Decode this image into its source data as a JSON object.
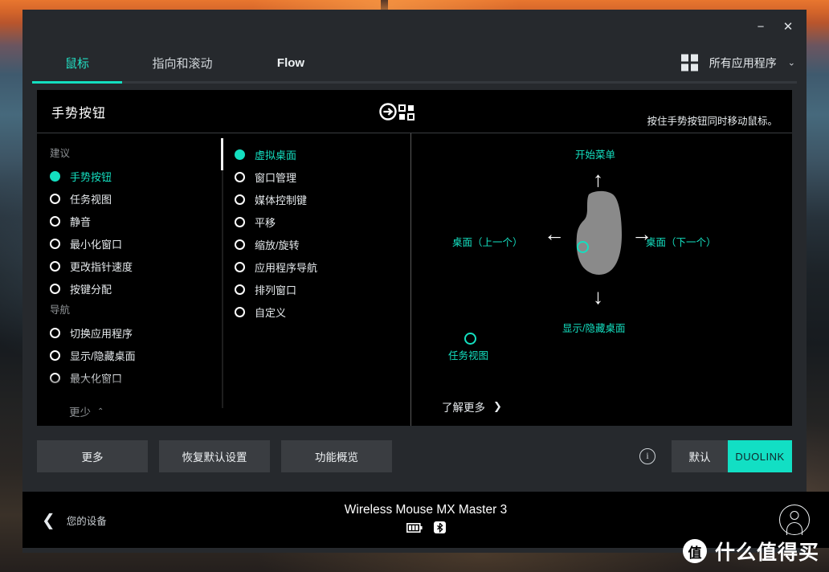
{
  "window": {
    "minimize_label": "−",
    "close_label": "✕"
  },
  "tabs": [
    {
      "label": "鼠标",
      "active": true
    },
    {
      "label": "指向和滚动",
      "active": false
    },
    {
      "label": "Flow",
      "active": false
    }
  ],
  "topbar": {
    "grid_icon": "grid-icon",
    "all_apps_label": "所有应用程序",
    "chevron": "⌄"
  },
  "card": {
    "title": "手势按钮",
    "head_icon": "gesture-button-icon",
    "hint": "按住手势按钮同时移动鼠标。"
  },
  "left_column": {
    "groups": [
      {
        "header": "建议",
        "items": [
          {
            "label": "手势按钮",
            "selected": true
          },
          {
            "label": "任务视图",
            "selected": false
          },
          {
            "label": "静音",
            "selected": false
          },
          {
            "label": "最小化窗口",
            "selected": false
          },
          {
            "label": "更改指针速度",
            "selected": false
          },
          {
            "label": "按键分配",
            "selected": false
          }
        ]
      },
      {
        "header": "导航",
        "items": [
          {
            "label": "切换应用程序",
            "selected": false
          },
          {
            "label": "显示/隐藏桌面",
            "selected": false
          },
          {
            "label": "最大化窗口",
            "selected": false
          }
        ]
      }
    ],
    "collapse_label": "更少",
    "collapse_caret": "⌃"
  },
  "mid_column": {
    "items": [
      {
        "label": "虚拟桌面",
        "selected": true
      },
      {
        "label": "窗口管理",
        "selected": false
      },
      {
        "label": "媒体控制键",
        "selected": false
      },
      {
        "label": "平移",
        "selected": false
      },
      {
        "label": "缩放/旋转",
        "selected": false
      },
      {
        "label": "应用程序导航",
        "selected": false
      },
      {
        "label": "排列窗口",
        "selected": false
      },
      {
        "label": "自定义",
        "selected": false
      }
    ]
  },
  "diagram": {
    "up_label": "开始菜单",
    "left_label": "桌面（上一个）",
    "right_label": "桌面（下一个）",
    "down_label": "显示/隐藏桌面",
    "press_label": "任务视图",
    "learn_more": "了解更多",
    "learn_more_chevron": "❯",
    "arrow_up": "↑",
    "arrow_left": "←",
    "arrow_right": "→",
    "arrow_down": "↓"
  },
  "buttons": {
    "more": "更多",
    "restore_defaults": "恢复默认设置",
    "feature_overview": "功能概览",
    "info_icon": "ⓘ",
    "default": "默认",
    "duolink": "DUOLINK"
  },
  "footer": {
    "back_chevron": "❮",
    "back_label": "您的设备",
    "device_name": "Wireless Mouse MX Master 3",
    "battery_icon": "battery-icon",
    "bluetooth_icon": "bluetooth-icon",
    "avatar": "user-avatar"
  },
  "watermark": {
    "logo_char": "值",
    "text": "什么值得买"
  },
  "colors": {
    "accent": "#14dfc0",
    "duolink_bg": "#12dfc4",
    "card_bg": "#000000",
    "window_bg": "#26292d",
    "button_bg": "#3a3d41"
  }
}
